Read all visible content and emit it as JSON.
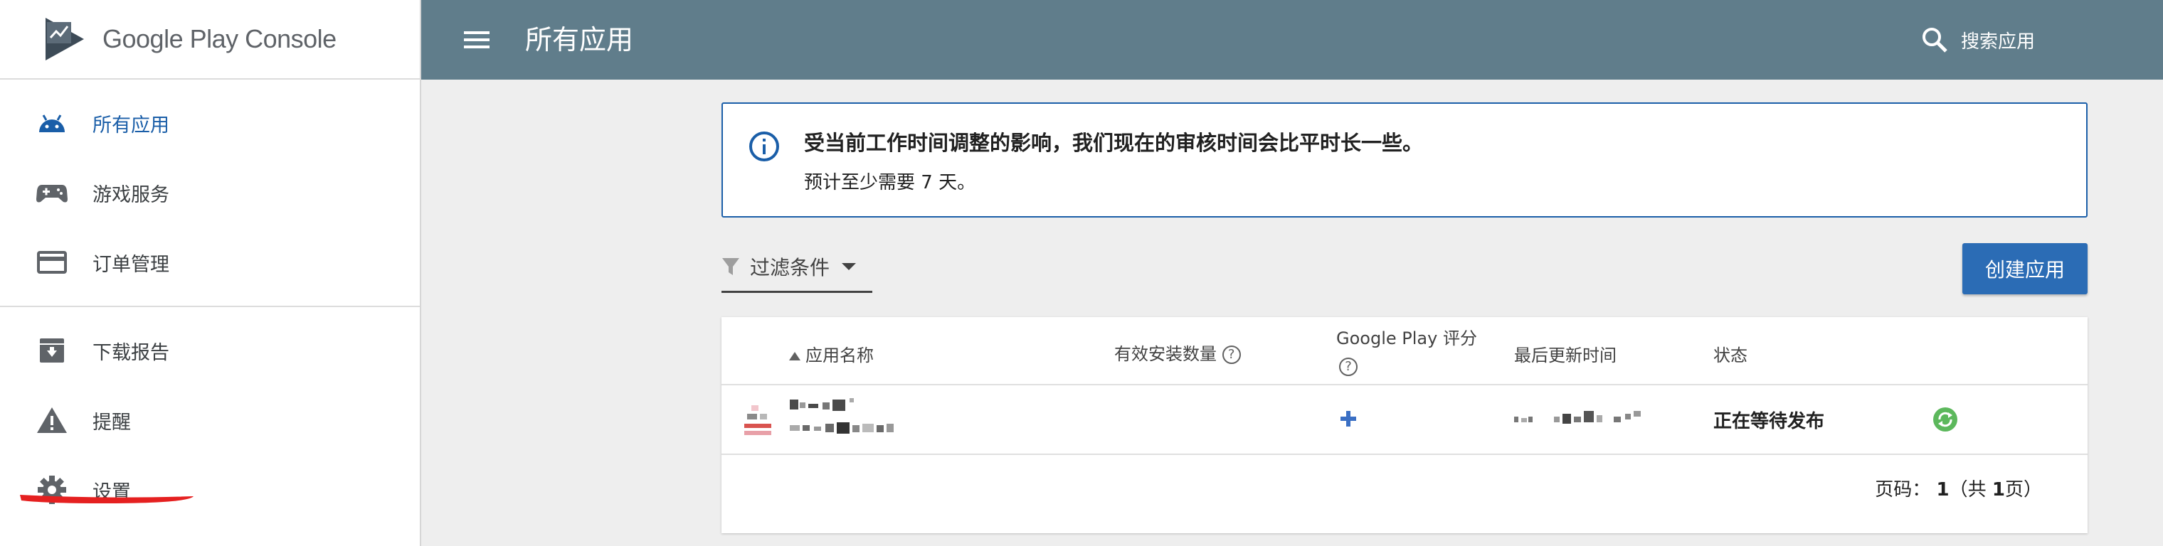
{
  "app": {
    "brand": "Google Play Console",
    "page_title": "所有应用"
  },
  "search": {
    "label": "搜索应用"
  },
  "sidebar": {
    "items": [
      {
        "label": "所有应用",
        "icon": "android-icon",
        "active": true
      },
      {
        "label": "游戏服务",
        "icon": "gamepad-icon"
      },
      {
        "label": "订单管理",
        "icon": "credit-card-icon"
      },
      {
        "label": "下载报告",
        "icon": "download-archive-icon"
      },
      {
        "label": "提醒",
        "icon": "warning-icon"
      },
      {
        "label": "设置",
        "icon": "gear-icon"
      }
    ]
  },
  "notice": {
    "title": "受当前工作时间调整的影响，我们现在的审核时间会比平时长一些。",
    "subtitle": "预计至少需要 7 天。",
    "icon": "info-icon"
  },
  "filter": {
    "label": "过滤条件"
  },
  "create_button": {
    "label": "创建应用"
  },
  "table": {
    "headers": {
      "app_name": "应用名称",
      "installs": "有效安装数量",
      "rating": "Google Play 评分",
      "updated": "最后更新时间",
      "status": "状态"
    },
    "rows": [
      {
        "status": "正在等待发布",
        "rating_icon": "plus-icon",
        "status_icon": "sync-icon"
      }
    ]
  },
  "pager": {
    "prefix": "页码：",
    "page": "1",
    "open": "（共",
    "total": "1",
    "close": "页）"
  },
  "colors": {
    "topbar": "#607d8b",
    "accent": "#1a5ea8",
    "button": "#2b6cb5",
    "annotation": "#e52020"
  }
}
